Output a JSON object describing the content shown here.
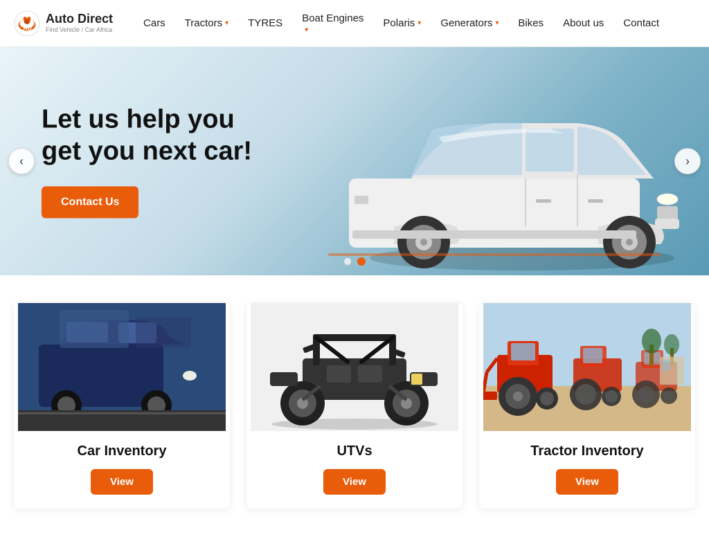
{
  "brand": {
    "title": "Auto Direct",
    "subtitle": "Find Vehicle / Car Africa",
    "logo_text": "AD"
  },
  "nav": {
    "items": [
      {
        "id": "cars",
        "label": "Cars",
        "has_dropdown": false
      },
      {
        "id": "tractors",
        "label": "Tractors",
        "has_dropdown": true
      },
      {
        "id": "tyres",
        "label": "TYRES",
        "has_dropdown": false
      },
      {
        "id": "boat-engines",
        "label": "Boat Engines",
        "has_dropdown": true
      },
      {
        "id": "polaris",
        "label": "Polaris",
        "has_dropdown": true
      },
      {
        "id": "generators",
        "label": "Generators",
        "has_dropdown": true
      },
      {
        "id": "bikes",
        "label": "Bikes",
        "has_dropdown": false
      },
      {
        "id": "about",
        "label": "About us",
        "has_dropdown": false
      },
      {
        "id": "contact",
        "label": "Contact",
        "has_dropdown": false
      }
    ]
  },
  "hero": {
    "title_line1": "Let us help you",
    "title_line2": "get you next car!",
    "cta_label": "Contact Us",
    "dot1_active": false,
    "dot2_active": true,
    "arrow_left": "‹",
    "arrow_right": "›"
  },
  "inventory": {
    "cards": [
      {
        "id": "cars",
        "title": "Car Inventory",
        "btn_label": "View",
        "bg_color": "#3a5a8a"
      },
      {
        "id": "utvs",
        "title": "UTVs",
        "btn_label": "View",
        "bg_color": "#2a2a2a"
      },
      {
        "id": "tractors",
        "title": "Tractor Inventory",
        "btn_label": "View",
        "bg_color": "#5a8a3a"
      }
    ]
  }
}
